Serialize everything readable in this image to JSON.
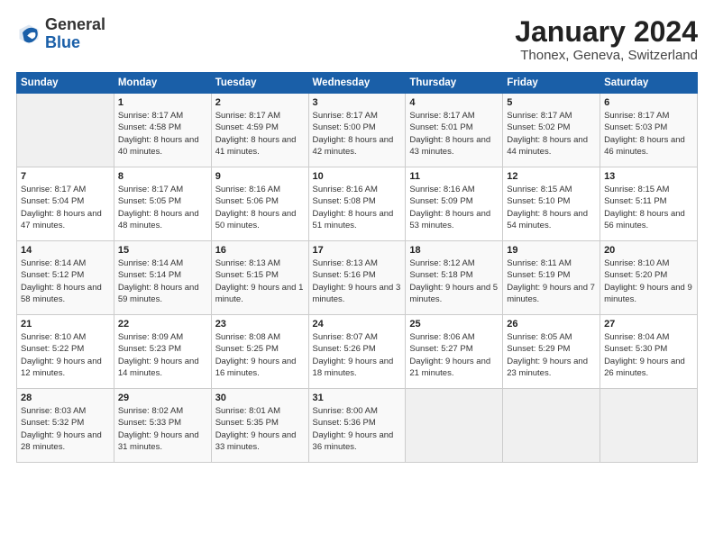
{
  "header": {
    "logo": {
      "general": "General",
      "blue": "Blue"
    },
    "title": "January 2024",
    "subtitle": "Thonex, Geneva, Switzerland"
  },
  "weekdays": [
    "Sunday",
    "Monday",
    "Tuesday",
    "Wednesday",
    "Thursday",
    "Friday",
    "Saturday"
  ],
  "weeks": [
    [
      {
        "num": "",
        "sunrise": "",
        "sunset": "",
        "daylight": ""
      },
      {
        "num": "1",
        "sunrise": "Sunrise: 8:17 AM",
        "sunset": "Sunset: 4:58 PM",
        "daylight": "Daylight: 8 hours and 40 minutes."
      },
      {
        "num": "2",
        "sunrise": "Sunrise: 8:17 AM",
        "sunset": "Sunset: 4:59 PM",
        "daylight": "Daylight: 8 hours and 41 minutes."
      },
      {
        "num": "3",
        "sunrise": "Sunrise: 8:17 AM",
        "sunset": "Sunset: 5:00 PM",
        "daylight": "Daylight: 8 hours and 42 minutes."
      },
      {
        "num": "4",
        "sunrise": "Sunrise: 8:17 AM",
        "sunset": "Sunset: 5:01 PM",
        "daylight": "Daylight: 8 hours and 43 minutes."
      },
      {
        "num": "5",
        "sunrise": "Sunrise: 8:17 AM",
        "sunset": "Sunset: 5:02 PM",
        "daylight": "Daylight: 8 hours and 44 minutes."
      },
      {
        "num": "6",
        "sunrise": "Sunrise: 8:17 AM",
        "sunset": "Sunset: 5:03 PM",
        "daylight": "Daylight: 8 hours and 46 minutes."
      }
    ],
    [
      {
        "num": "7",
        "sunrise": "Sunrise: 8:17 AM",
        "sunset": "Sunset: 5:04 PM",
        "daylight": "Daylight: 8 hours and 47 minutes."
      },
      {
        "num": "8",
        "sunrise": "Sunrise: 8:17 AM",
        "sunset": "Sunset: 5:05 PM",
        "daylight": "Daylight: 8 hours and 48 minutes."
      },
      {
        "num": "9",
        "sunrise": "Sunrise: 8:16 AM",
        "sunset": "Sunset: 5:06 PM",
        "daylight": "Daylight: 8 hours and 50 minutes."
      },
      {
        "num": "10",
        "sunrise": "Sunrise: 8:16 AM",
        "sunset": "Sunset: 5:08 PM",
        "daylight": "Daylight: 8 hours and 51 minutes."
      },
      {
        "num": "11",
        "sunrise": "Sunrise: 8:16 AM",
        "sunset": "Sunset: 5:09 PM",
        "daylight": "Daylight: 8 hours and 53 minutes."
      },
      {
        "num": "12",
        "sunrise": "Sunrise: 8:15 AM",
        "sunset": "Sunset: 5:10 PM",
        "daylight": "Daylight: 8 hours and 54 minutes."
      },
      {
        "num": "13",
        "sunrise": "Sunrise: 8:15 AM",
        "sunset": "Sunset: 5:11 PM",
        "daylight": "Daylight: 8 hours and 56 minutes."
      }
    ],
    [
      {
        "num": "14",
        "sunrise": "Sunrise: 8:14 AM",
        "sunset": "Sunset: 5:12 PM",
        "daylight": "Daylight: 8 hours and 58 minutes."
      },
      {
        "num": "15",
        "sunrise": "Sunrise: 8:14 AM",
        "sunset": "Sunset: 5:14 PM",
        "daylight": "Daylight: 8 hours and 59 minutes."
      },
      {
        "num": "16",
        "sunrise": "Sunrise: 8:13 AM",
        "sunset": "Sunset: 5:15 PM",
        "daylight": "Daylight: 9 hours and 1 minute."
      },
      {
        "num": "17",
        "sunrise": "Sunrise: 8:13 AM",
        "sunset": "Sunset: 5:16 PM",
        "daylight": "Daylight: 9 hours and 3 minutes."
      },
      {
        "num": "18",
        "sunrise": "Sunrise: 8:12 AM",
        "sunset": "Sunset: 5:18 PM",
        "daylight": "Daylight: 9 hours and 5 minutes."
      },
      {
        "num": "19",
        "sunrise": "Sunrise: 8:11 AM",
        "sunset": "Sunset: 5:19 PM",
        "daylight": "Daylight: 9 hours and 7 minutes."
      },
      {
        "num": "20",
        "sunrise": "Sunrise: 8:10 AM",
        "sunset": "Sunset: 5:20 PM",
        "daylight": "Daylight: 9 hours and 9 minutes."
      }
    ],
    [
      {
        "num": "21",
        "sunrise": "Sunrise: 8:10 AM",
        "sunset": "Sunset: 5:22 PM",
        "daylight": "Daylight: 9 hours and 12 minutes."
      },
      {
        "num": "22",
        "sunrise": "Sunrise: 8:09 AM",
        "sunset": "Sunset: 5:23 PM",
        "daylight": "Daylight: 9 hours and 14 minutes."
      },
      {
        "num": "23",
        "sunrise": "Sunrise: 8:08 AM",
        "sunset": "Sunset: 5:25 PM",
        "daylight": "Daylight: 9 hours and 16 minutes."
      },
      {
        "num": "24",
        "sunrise": "Sunrise: 8:07 AM",
        "sunset": "Sunset: 5:26 PM",
        "daylight": "Daylight: 9 hours and 18 minutes."
      },
      {
        "num": "25",
        "sunrise": "Sunrise: 8:06 AM",
        "sunset": "Sunset: 5:27 PM",
        "daylight": "Daylight: 9 hours and 21 minutes."
      },
      {
        "num": "26",
        "sunrise": "Sunrise: 8:05 AM",
        "sunset": "Sunset: 5:29 PM",
        "daylight": "Daylight: 9 hours and 23 minutes."
      },
      {
        "num": "27",
        "sunrise": "Sunrise: 8:04 AM",
        "sunset": "Sunset: 5:30 PM",
        "daylight": "Daylight: 9 hours and 26 minutes."
      }
    ],
    [
      {
        "num": "28",
        "sunrise": "Sunrise: 8:03 AM",
        "sunset": "Sunset: 5:32 PM",
        "daylight": "Daylight: 9 hours and 28 minutes."
      },
      {
        "num": "29",
        "sunrise": "Sunrise: 8:02 AM",
        "sunset": "Sunset: 5:33 PM",
        "daylight": "Daylight: 9 hours and 31 minutes."
      },
      {
        "num": "30",
        "sunrise": "Sunrise: 8:01 AM",
        "sunset": "Sunset: 5:35 PM",
        "daylight": "Daylight: 9 hours and 33 minutes."
      },
      {
        "num": "31",
        "sunrise": "Sunrise: 8:00 AM",
        "sunset": "Sunset: 5:36 PM",
        "daylight": "Daylight: 9 hours and 36 minutes."
      },
      {
        "num": "",
        "sunrise": "",
        "sunset": "",
        "daylight": ""
      },
      {
        "num": "",
        "sunrise": "",
        "sunset": "",
        "daylight": ""
      },
      {
        "num": "",
        "sunrise": "",
        "sunset": "",
        "daylight": ""
      }
    ]
  ]
}
